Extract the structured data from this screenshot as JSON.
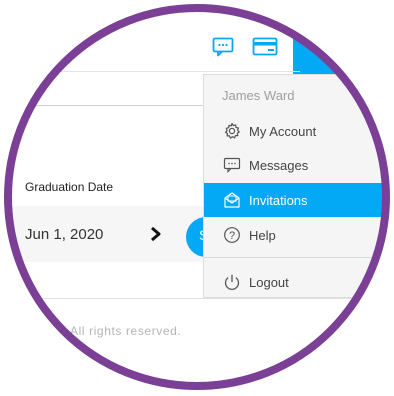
{
  "menu": {
    "user_name": "James Ward",
    "items": [
      {
        "label": "My Account",
        "icon": "gear-icon"
      },
      {
        "label": "Messages",
        "icon": "chat-icon"
      },
      {
        "label": "Invitations",
        "icon": "envelope-icon",
        "active": true
      },
      {
        "label": "Help",
        "icon": "help-icon"
      },
      {
        "label": "Logout",
        "icon": "power-icon"
      }
    ]
  },
  "form": {
    "graduation_label": "Graduation Date",
    "graduation_value": "Jun 1, 2020",
    "next_button_text": "S"
  },
  "footer": {
    "text": "All rights reserved."
  },
  "colors": {
    "accent": "#03a9f4",
    "ring": "#7b3f96"
  }
}
